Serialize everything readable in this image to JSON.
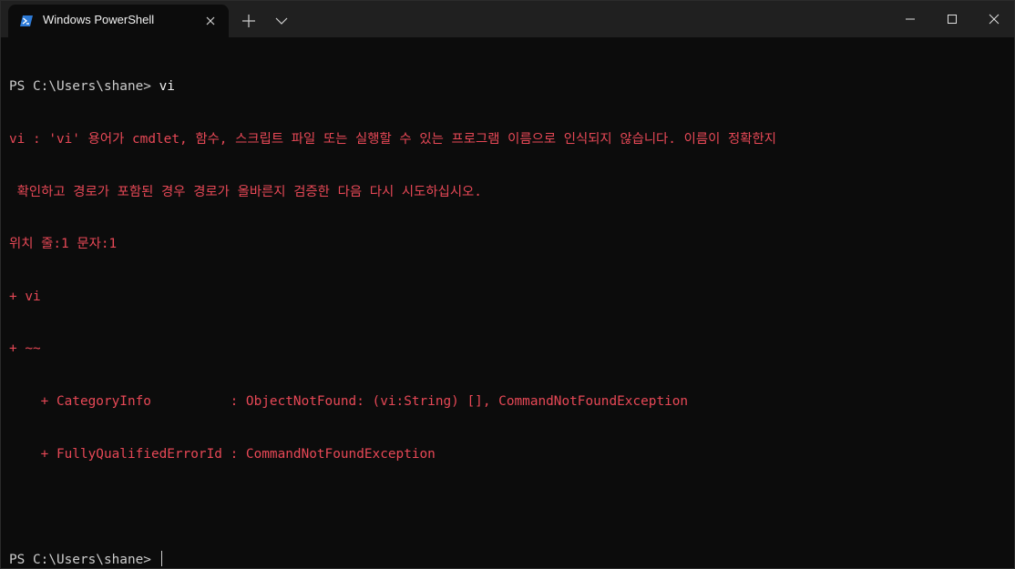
{
  "window": {
    "tab_title": "Windows PowerShell"
  },
  "icons": {
    "tab": "powershell-icon",
    "tab_close": "close-icon",
    "new_tab": "plus-icon",
    "dropdown": "chevron-down-icon",
    "minimize": "minimize-icon",
    "maximize": "maximize-icon",
    "close": "close-icon"
  },
  "colors": {
    "background": "#0c0c0c",
    "titlebar": "#202020",
    "text": "#cccccc",
    "error": "#e74856"
  },
  "terminal": {
    "prompt1": "PS C:\\Users\\shane> ",
    "command1": "vi",
    "error_lines": [
      "vi : 'vi' 용어가 cmdlet, 함수, 스크립트 파일 또는 실행할 수 있는 프로그램 이름으로 인식되지 않습니다. 이름이 정확한지",
      " 확인하고 경로가 포함된 경우 경로가 올바른지 검증한 다음 다시 시도하십시오.",
      "위치 줄:1 문자:1",
      "+ vi",
      "+ ~~",
      "    + CategoryInfo          : ObjectNotFound: (vi:String) [], CommandNotFoundException",
      "    + FullyQualifiedErrorId : CommandNotFoundException"
    ],
    "prompt2": "PS C:\\Users\\shane> "
  }
}
